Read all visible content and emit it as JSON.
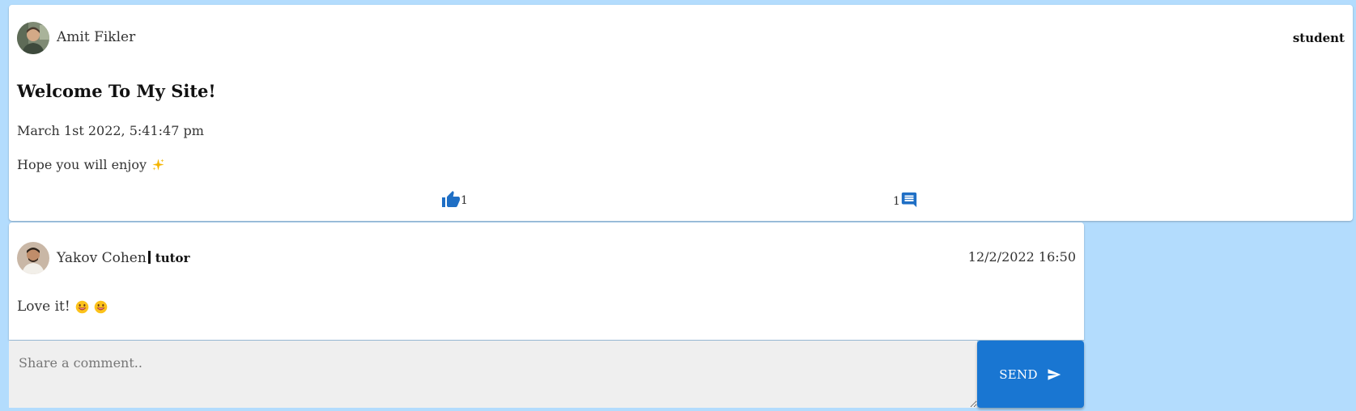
{
  "post": {
    "author_name": "Amit Fikler",
    "author_role": "student",
    "title": "Welcome To My Site!",
    "date": "March 1st 2022, 5:41:47 pm",
    "body": "Hope you will enjoy",
    "body_emoji": "sparkles-icon",
    "likes_count": "1",
    "comments_count": "1"
  },
  "comment": {
    "author_name": "Yakov Cohen",
    "author_role": "tutor",
    "timestamp": "12/2/2022 16:50",
    "text": "Love it!",
    "emojis": [
      "grinning-face-icon",
      "grinning-face-icon"
    ]
  },
  "form": {
    "placeholder": "Share a comment..",
    "send_label": "SEND"
  },
  "colors": {
    "page_background": "#b3dcfd",
    "accent": "#1976d2",
    "input_background": "#efefef"
  }
}
